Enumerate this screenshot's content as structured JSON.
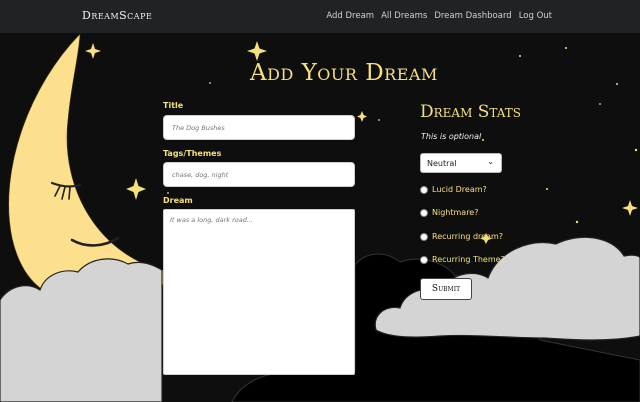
{
  "nav": {
    "brand": "DreamScape",
    "links": [
      "Add Dream",
      "All Dreams",
      "Dream Dashboard",
      "Log Out"
    ]
  },
  "form": {
    "heading": "Add Your Dream",
    "title_label": "Title",
    "title_placeholder": "The Dog Bushes",
    "tags_label": "Tags/Themes",
    "tags_placeholder": "chase, dog, night",
    "dream_label": "Dream",
    "dream_placeholder": "It was a long, dark road..."
  },
  "stats": {
    "heading": "Dream Stats",
    "subtitle": "This is optional",
    "mood_selected": "Neutral",
    "options": [
      "Lucid Dream?",
      "Nightmare?",
      "Recurring dream?",
      "Recurring Theme?"
    ],
    "submit_label": "Submit"
  },
  "colors": {
    "accent": "#f6e07b",
    "moon": "#fde08e",
    "cloud": "#d4d4d4",
    "navbar": "#202325",
    "background": "#0e0e0e"
  }
}
